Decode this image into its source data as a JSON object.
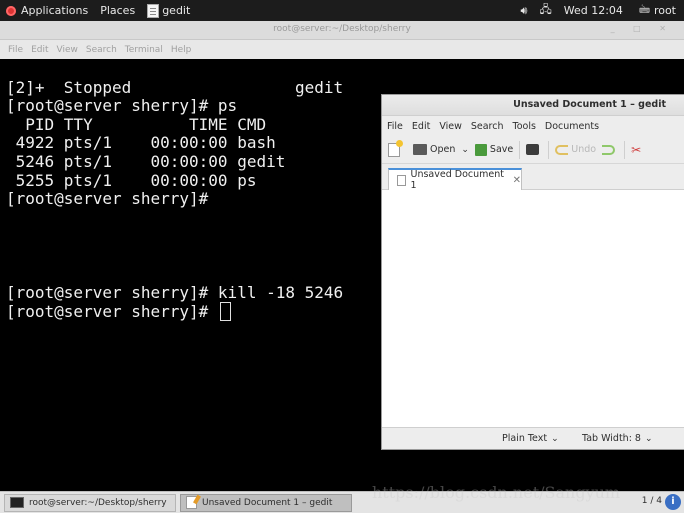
{
  "topbar": {
    "applications": "Applications",
    "places": "Places",
    "active_app": "gedit",
    "clock": "Wed 12:04",
    "user": "root"
  },
  "terminal": {
    "title": "root@server:~/Desktop/sherry",
    "menu": [
      "File",
      "Edit",
      "View",
      "Search",
      "Terminal",
      "Help"
    ],
    "lines": [
      "[2]+  Stopped                 gedit",
      "[root@server sherry]# ps",
      "  PID TTY          TIME CMD",
      " 4922 pts/1    00:00:00 bash",
      " 5246 pts/1    00:00:00 gedit",
      " 5255 pts/1    00:00:00 ps",
      "[root@server sherry]#",
      "[root@server sherry]# kill -18 5246",
      "[root@server sherry]# "
    ]
  },
  "gedit": {
    "title": "Unsaved Document 1 – gedit",
    "menu": [
      "File",
      "Edit",
      "View",
      "Search",
      "Tools",
      "Documents"
    ],
    "toolbar": {
      "open": "Open",
      "save": "Save",
      "undo": "Undo"
    },
    "tab_label": "Unsaved Document 1",
    "status": {
      "language": "Plain Text",
      "tab_width": "Tab Width:  8"
    }
  },
  "taskbar": {
    "terminal_task": "root@server:~/Desktop/sherry",
    "gedit_task": "Unsaved Document 1 – gedit",
    "pager": "1 / 4"
  },
  "watermark": "https://blog.csdn.net/Sangyum"
}
